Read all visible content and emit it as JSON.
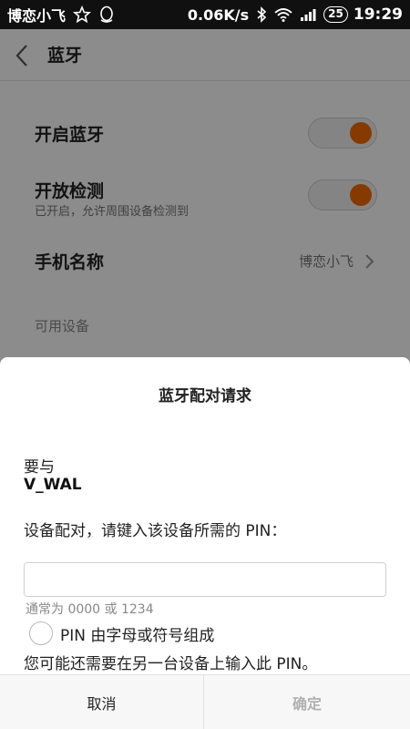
{
  "status_bar": {
    "carrier": "博恋小飞",
    "speed": "0.06K/s",
    "battery": "25",
    "time": "19:29"
  },
  "header": {
    "title": "蓝牙"
  },
  "settings": {
    "bluetooth_on": {
      "label": "开启蓝牙",
      "enabled": true
    },
    "discoverable": {
      "label": "开放检测",
      "subtitle": "已开启，允许周围设备检测到",
      "enabled": true
    },
    "device_name": {
      "label": "手机名称",
      "value": "博恋小飞"
    },
    "available_header": "可用设备"
  },
  "dialog": {
    "title": "蓝牙配对请求",
    "line1": "要与",
    "device": "V_WAL",
    "instruction": "设备配对，请键入该设备所需的 PIN：",
    "pin_value": "",
    "pin_hint": "通常为 0000 或 1234",
    "checkbox_label": "PIN 由字母或符号组成",
    "note": "您可能还需要在另一台设备上输入此 PIN。",
    "cancel_label": "取消",
    "ok_label": "确定"
  },
  "colors": {
    "accent": "#f56a00",
    "status_bar_bg": "#101010"
  }
}
